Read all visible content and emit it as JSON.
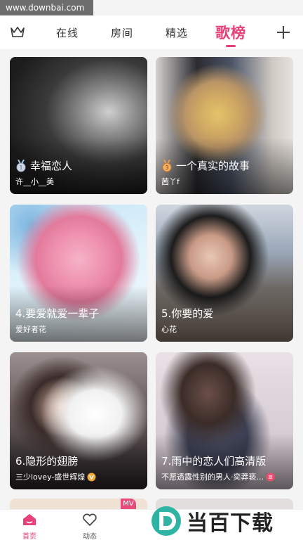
{
  "watermark": {
    "text": "www.downbai.com"
  },
  "tabs": [
    {
      "label": "在线"
    },
    {
      "label": "房间"
    },
    {
      "label": "精选"
    },
    {
      "label": "歌榜"
    }
  ],
  "icons": {
    "left": "crown-icon",
    "right": "plus-icon"
  },
  "colors": {
    "accent": "#e8407a"
  },
  "cards": [
    {
      "title": "幸福恋人",
      "sub": "许__小__美",
      "medal": "1"
    },
    {
      "title": "一个真实的故事",
      "sub": "茜丫f",
      "medal": "3"
    },
    {
      "title": "4.要爱就爱一辈子",
      "sub": "爱好者花"
    },
    {
      "title": "5.你要的爱",
      "sub": "心花"
    },
    {
      "title": "6.隐形的翅膀",
      "sub": "三少lovey-盛世辉煌"
    },
    {
      "title": "7.雨中的恋人们高清版",
      "sub": "不愿透露性别的男人·奕莽亵..."
    }
  ],
  "peek": {
    "mv": "MV"
  },
  "nav": [
    {
      "label": "首页"
    },
    {
      "label": "动态"
    }
  ],
  "brand": {
    "text": "当百下载"
  }
}
